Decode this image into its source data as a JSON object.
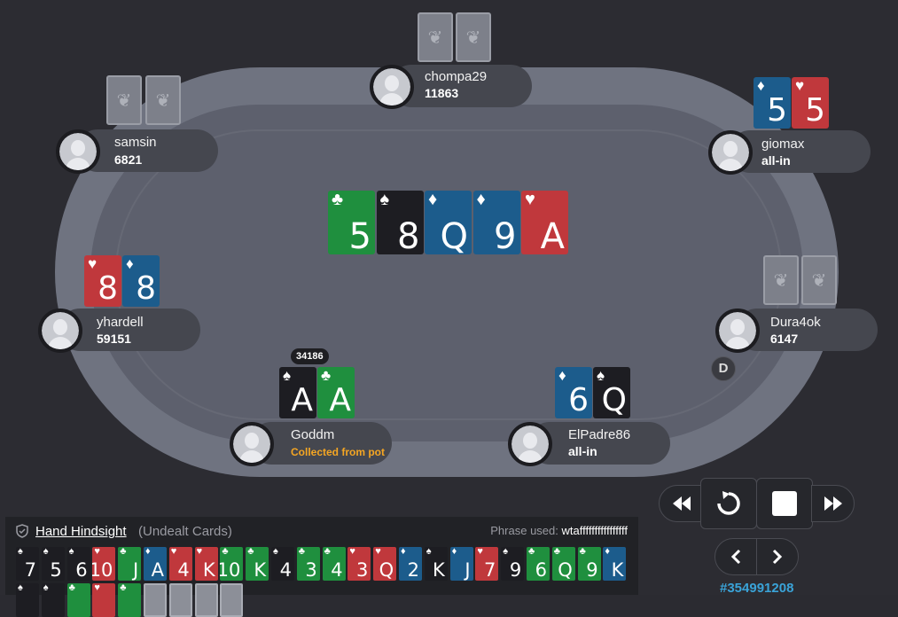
{
  "players": {
    "chompa29": {
      "name": "chompa29",
      "stack": "11863"
    },
    "samsin": {
      "name": "samsin",
      "stack": "6821"
    },
    "giomax": {
      "name": "giomax",
      "stack": "all-in",
      "cards": [
        {
          "rank": "5",
          "suit": "♦",
          "color": "blue"
        },
        {
          "rank": "5",
          "suit": "♥",
          "color": "red"
        }
      ]
    },
    "yhardell": {
      "name": "yhardell",
      "stack": "59151",
      "cards": [
        {
          "rank": "8",
          "suit": "♥",
          "color": "red"
        },
        {
          "rank": "8",
          "suit": "♦",
          "color": "blue"
        }
      ]
    },
    "dura4ok": {
      "name": "Dura4ok",
      "stack": "6147"
    },
    "goddm": {
      "name": "Goddm",
      "status": "Collected from pot",
      "bet": "34186",
      "cards": [
        {
          "rank": "A",
          "suit": "♠",
          "color": "black"
        },
        {
          "rank": "A",
          "suit": "♣",
          "color": "green"
        }
      ]
    },
    "elpadre": {
      "name": "ElPadre86",
      "stack": "all-in",
      "cards": [
        {
          "rank": "6",
          "suit": "♦",
          "color": "blue"
        },
        {
          "rank": "Q",
          "suit": "♠",
          "color": "black"
        }
      ]
    }
  },
  "board": [
    {
      "rank": "5",
      "suit": "♣",
      "color": "green"
    },
    {
      "rank": "8",
      "suit": "♠",
      "color": "black"
    },
    {
      "rank": "Q",
      "suit": "♦",
      "color": "blue"
    },
    {
      "rank": "9",
      "suit": "♦",
      "color": "blue"
    },
    {
      "rank": "A",
      "suit": "♥",
      "color": "red"
    }
  ],
  "dealer_label": "D",
  "hindsight": {
    "title": "Hand Hindsight",
    "subtitle": "(Undealt Cards)",
    "phrase_label": "Phrase used:",
    "phrase": "wtaffffffffffffffff",
    "row1": [
      {
        "rank": "7",
        "suit": "♠",
        "color": "black"
      },
      {
        "rank": "5",
        "suit": "♠",
        "color": "black"
      },
      {
        "rank": "6",
        "suit": "♠",
        "color": "black"
      },
      {
        "rank": "10",
        "suit": "♥",
        "color": "red"
      },
      {
        "rank": "J",
        "suit": "♣",
        "color": "green"
      },
      {
        "rank": "A",
        "suit": "♦",
        "color": "blue"
      },
      {
        "rank": "4",
        "suit": "♥",
        "color": "red"
      },
      {
        "rank": "K",
        "suit": "♥",
        "color": "red"
      },
      {
        "rank": "10",
        "suit": "♣",
        "color": "green"
      },
      {
        "rank": "K",
        "suit": "♣",
        "color": "green"
      },
      {
        "rank": "4",
        "suit": "♠",
        "color": "black"
      },
      {
        "rank": "3",
        "suit": "♣",
        "color": "green"
      },
      {
        "rank": "4",
        "suit": "♣",
        "color": "green"
      },
      {
        "rank": "3",
        "suit": "♥",
        "color": "red"
      },
      {
        "rank": "Q",
        "suit": "♥",
        "color": "red"
      },
      {
        "rank": "2",
        "suit": "♦",
        "color": "blue"
      },
      {
        "rank": "K",
        "suit": "♠",
        "color": "black"
      },
      {
        "rank": "J",
        "suit": "♦",
        "color": "blue"
      },
      {
        "rank": "7",
        "suit": "♥",
        "color": "red"
      },
      {
        "rank": "9",
        "suit": "♠",
        "color": "black"
      },
      {
        "rank": "6",
        "suit": "♣",
        "color": "green"
      },
      {
        "rank": "Q",
        "suit": "♣",
        "color": "green"
      },
      {
        "rank": "9",
        "suit": "♣",
        "color": "green"
      },
      {
        "rank": "K",
        "suit": "♦",
        "color": "blue"
      }
    ],
    "row2": [
      {
        "suit": "♠",
        "color": "black"
      },
      {
        "suit": "♠",
        "color": "black"
      },
      {
        "suit": "♣",
        "color": "green"
      },
      {
        "suit": "♥",
        "color": "red"
      },
      {
        "suit": "♣",
        "color": "green"
      },
      {
        "back": true
      },
      {
        "back": true
      },
      {
        "back": true
      },
      {
        "back": true
      }
    ]
  },
  "hand_id": "#354991208",
  "controls": [
    "rewind-icon",
    "replay-icon",
    "stop-icon",
    "fast-forward-icon",
    "prev-icon",
    "next-icon"
  ]
}
